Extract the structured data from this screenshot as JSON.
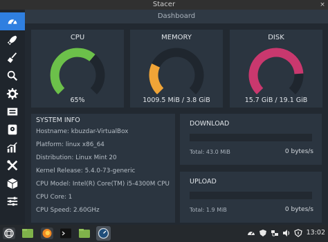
{
  "window": {
    "title": "Stacer",
    "close_symbol": "×"
  },
  "header": {
    "title": "Dashboard"
  },
  "sidebar": {
    "items": [
      {
        "name": "dashboard",
        "icon": "speedometer-icon",
        "active": true
      },
      {
        "name": "system-cleaner",
        "icon": "rocket-icon",
        "active": false
      },
      {
        "name": "startup-apps",
        "icon": "broom-icon",
        "active": false
      },
      {
        "name": "search",
        "icon": "search-icon",
        "active": false
      },
      {
        "name": "services",
        "icon": "gear-icon",
        "active": false
      },
      {
        "name": "processes",
        "icon": "processor-icon",
        "active": false
      },
      {
        "name": "uninstaller",
        "icon": "disk-icon",
        "active": false
      },
      {
        "name": "resources",
        "icon": "chart-icon",
        "active": false
      },
      {
        "name": "helpers",
        "icon": "tools-icon",
        "active": false
      },
      {
        "name": "apt-repository",
        "icon": "package-icon",
        "active": false
      },
      {
        "name": "gnome-settings",
        "icon": "sliders-icon",
        "active": false
      }
    ]
  },
  "gauges": [
    {
      "title": "CPU",
      "value": "65%",
      "percent": 0.65,
      "color": "#6cc04a"
    },
    {
      "title": "MEMORY",
      "value": "1009.5 MiB / 3.8 GiB",
      "percent": 0.26,
      "color": "#f0a437"
    },
    {
      "title": "DISK",
      "value": "15.7 GiB / 19.1 GiB",
      "percent": 0.82,
      "color": "#c9386e"
    }
  ],
  "system_info": {
    "title": "SYSTEM INFO",
    "rows": [
      "Hostname: kbuzdar-VirtualBox",
      "Platform: linux x86_64",
      "Distribution: Linux Mint 20",
      "Kernel Release: 5.4.0-73-generic",
      "CPU Model: Intel(R) Core(TM) i5-4300M CPU",
      "CPU Core: 1",
      "CPU Speed: 2.60GHz"
    ]
  },
  "download": {
    "title": "DOWNLOAD",
    "total": "Total: 43.0 MiB",
    "speed": "0 bytes/s"
  },
  "upload": {
    "title": "UPLOAD",
    "total": "Total: 1.9 MiB",
    "speed": "0 bytes/s"
  },
  "taskbar": {
    "apps": [
      "mint-menu-icon",
      "files-icon",
      "firefox-icon",
      "terminal-icon",
      "folder-icon",
      "stacer-icon"
    ],
    "tray": [
      "stacer-tray-icon",
      "shield-icon",
      "network-icon",
      "volume-icon",
      "updates-icon"
    ],
    "clock": "13:02"
  },
  "colors": {
    "accent": "#2f7fe0",
    "track": "#1f262e"
  }
}
